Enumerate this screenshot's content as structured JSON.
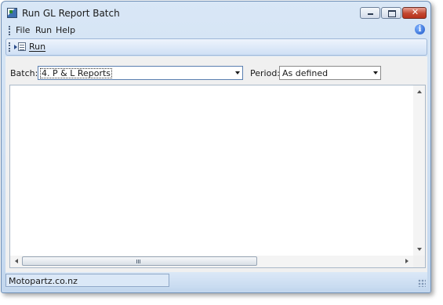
{
  "window": {
    "title": "Run GL Report Batch",
    "icons": {
      "app": "report-batch-icon",
      "info": "info-icon"
    }
  },
  "menu": {
    "items": [
      "File",
      "Run",
      "Help"
    ]
  },
  "toolbar": {
    "run_label": "Run",
    "run_icon": "run-report-icon"
  },
  "form": {
    "batch_label": "Batch:",
    "batch_value": "4. P & L Reports",
    "period_label": "Period:",
    "period_value": "As defined"
  },
  "status": {
    "company": "Motopartz.co.nz"
  },
  "colors": {
    "accent": "#c3d7ee",
    "close_button": "#c2462f",
    "panel_background": "#f0f0f0"
  }
}
